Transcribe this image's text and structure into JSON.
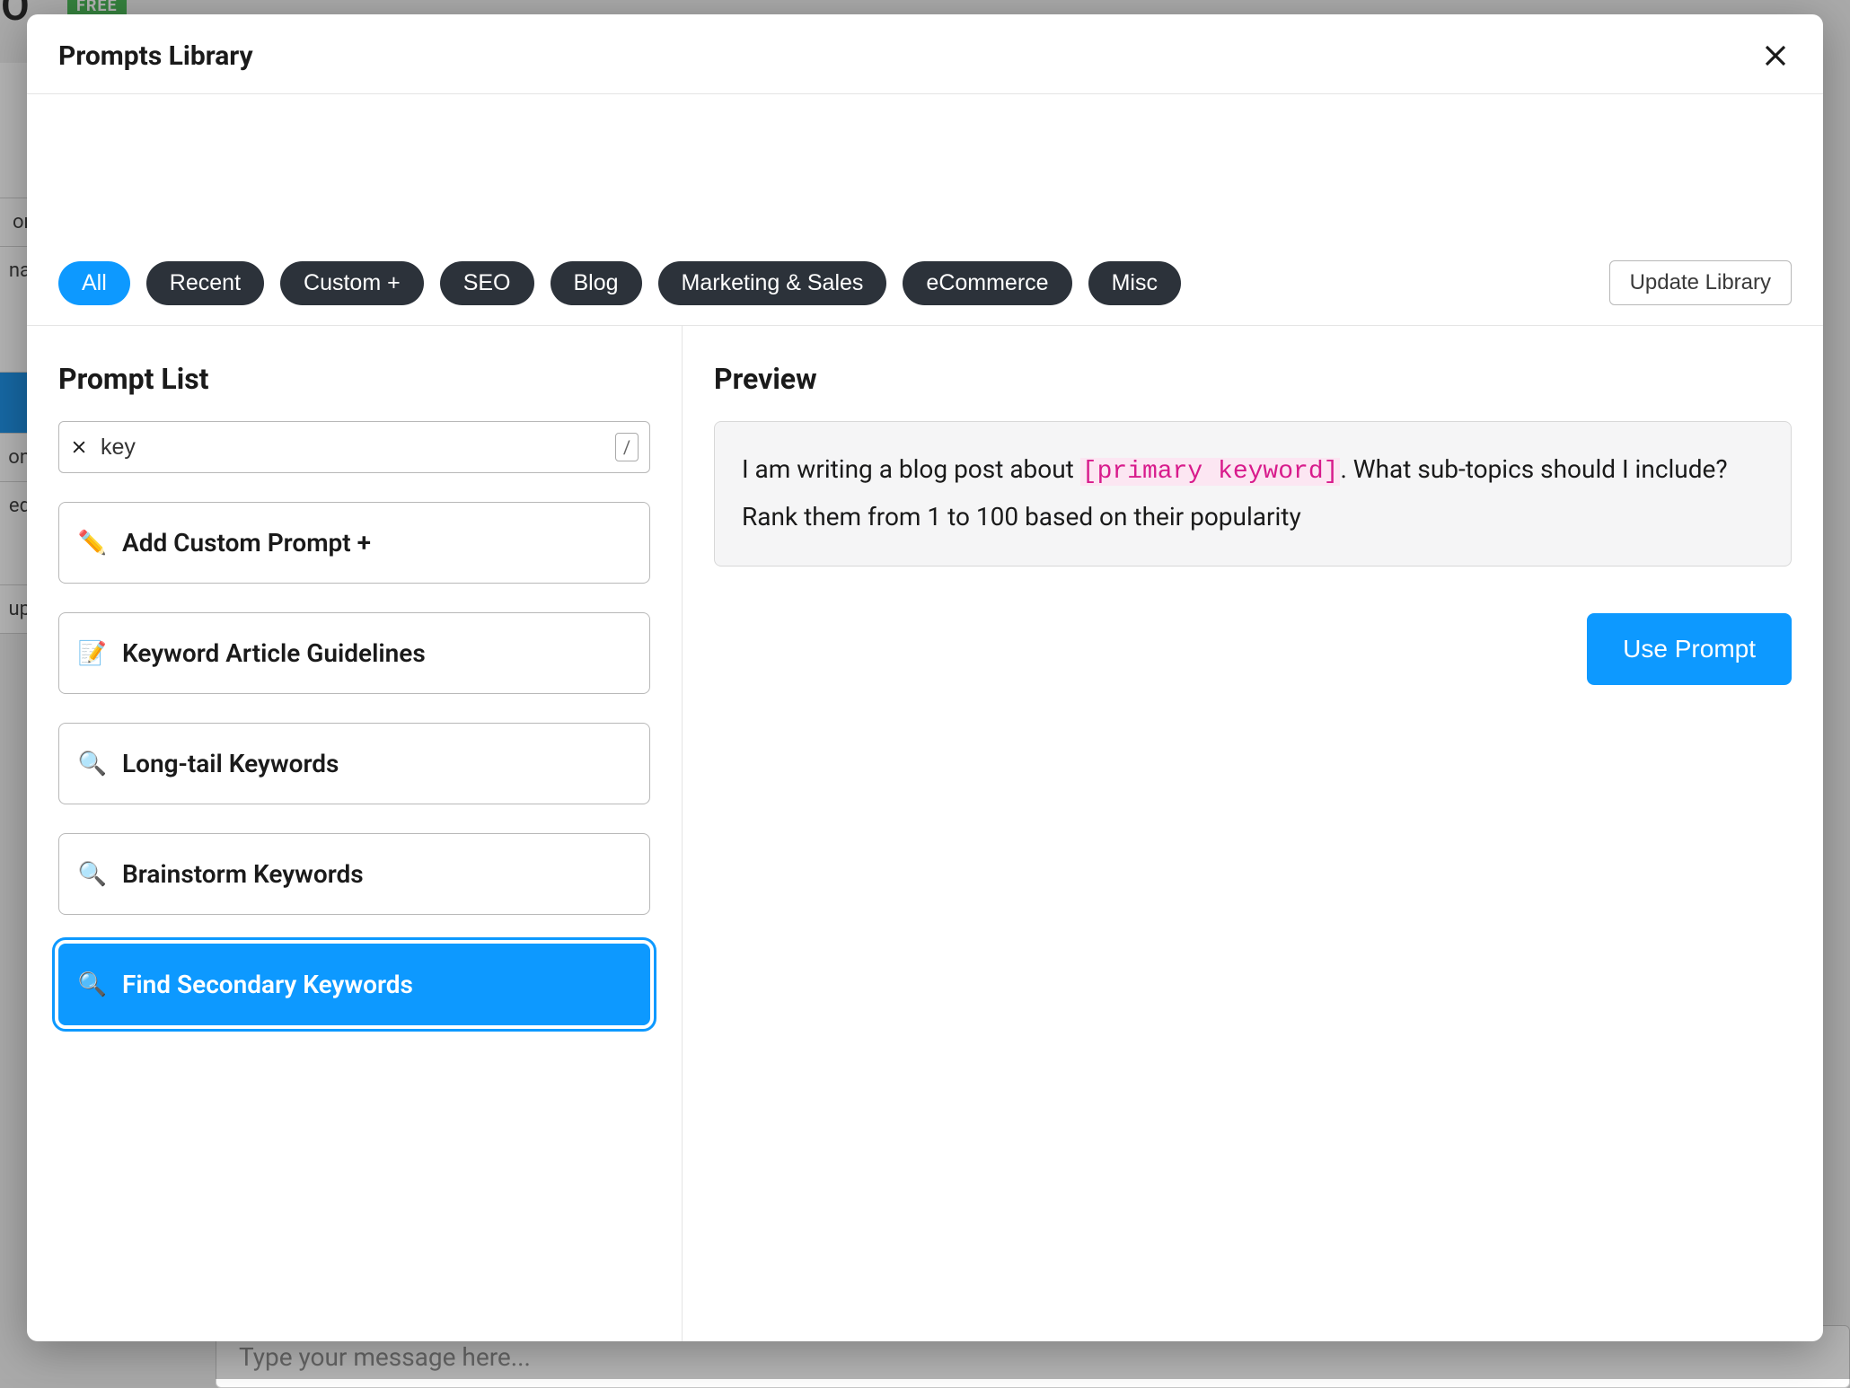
{
  "background": {
    "eo_text": "EO",
    "free_badge": "FREE",
    "sidebar_items": [
      "or",
      "na",
      "",
      "on",
      "ed",
      "up"
    ],
    "message_placeholder": "Type your message here..."
  },
  "modal": {
    "title": "Prompts Library",
    "close_label": "×",
    "update_button": "Update Library",
    "filters": [
      {
        "label": "All",
        "active": true
      },
      {
        "label": "Recent",
        "active": false
      },
      {
        "label": "Custom +",
        "active": false
      },
      {
        "label": "SEO",
        "active": false
      },
      {
        "label": "Blog",
        "active": false
      },
      {
        "label": "Marketing & Sales",
        "active": false
      },
      {
        "label": "eCommerce",
        "active": false
      },
      {
        "label": "Misc",
        "active": false
      }
    ],
    "left": {
      "title": "Prompt List",
      "search_value": "key",
      "slash_hint": "/",
      "items": [
        {
          "icon": "✏️",
          "label": "Add Custom Prompt +",
          "selected": false,
          "icon_name": "pencil-icon"
        },
        {
          "icon": "📝",
          "label": "Keyword Article Guidelines",
          "selected": false,
          "icon_name": "memo-icon"
        },
        {
          "icon": "🔍",
          "label": "Long-tail Keywords",
          "selected": false,
          "icon_name": "magnifying-glass-icon"
        },
        {
          "icon": "🔍",
          "label": "Brainstorm Keywords",
          "selected": false,
          "icon_name": "magnifying-glass-icon"
        },
        {
          "icon": "🔍",
          "label": "Find Secondary Keywords",
          "selected": true,
          "icon_name": "magnifying-glass-icon"
        }
      ]
    },
    "right": {
      "title": "Preview",
      "preview_before": "I am writing a blog post about ",
      "preview_variable": "[primary keyword]",
      "preview_after": ". What sub-topics should I include? Rank them from 1 to 100 based on their popularity",
      "use_button": "Use Prompt"
    }
  }
}
